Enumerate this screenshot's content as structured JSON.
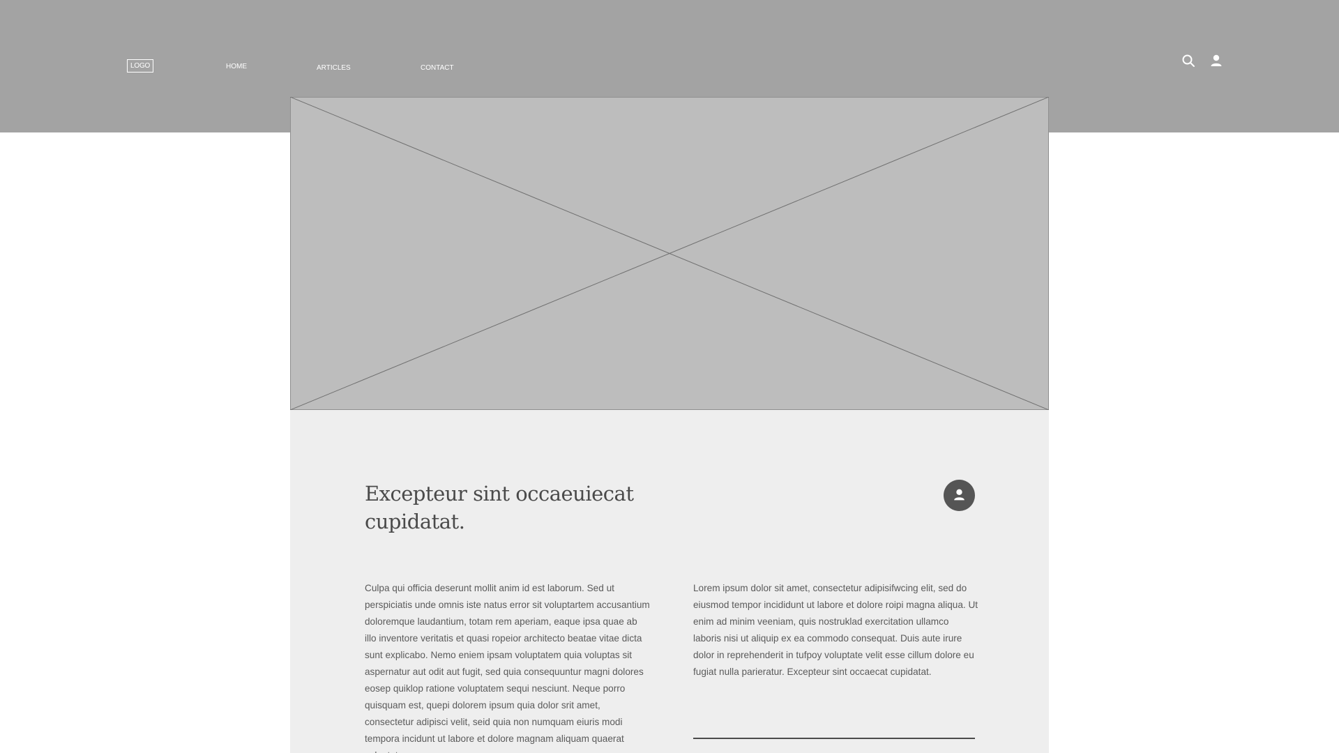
{
  "header": {
    "logo": "LOGO",
    "nav": {
      "home": "HOME",
      "articles": "ARTICLES",
      "contact": "CONTACT"
    },
    "icons": {
      "search": "search-icon",
      "user": "user-icon"
    }
  },
  "hero": {
    "type": "image-placeholder"
  },
  "article": {
    "title": "Excepteur sint occaeuiecat cupidatat.",
    "author_icon": "user-icon",
    "col_left": "Culpa qui officia deserunt mollit anim id est laborum. Sed ut perspiciatis unde omnis iste natus error sit voluptartem accusantium doloremque laudantium, totam rem aperiam, eaque ipsa quae ab illo inventore veritatis et quasi ropeior architecto beatae vitae dicta sunt explicabo. Nemo eniem ipsam voluptatem quia voluptas sit aspernatur aut odit aut fugit, sed quia consequuntur magni dolores eosep quiklop ratione voluptatem sequi nesciunt. Neque porro quisquam est, quepi dolorem ipsum quia dolor srit amet, consectetur adipisci velit, seid quia non numquam eiuris modi tempora incidunt ut labore et dolore magnam aliquam quaerat voluptatem.",
    "col_right": "Lorem ipsum dolor sit amet, consectetur adipisifwcing elit, sed do eiusmod tempor incididunt ut labore et dolore roipi magna aliqua. Ut enim ad minim veeniam, quis nostruklad exercitation ullamco laboris nisi ut aliquip ex ea commodo consequat. Duis aute irure dolor in reprehenderit in tufpoy voluptate velit esse cillum dolore eu fugiat nulla parieratur. Excepteur sint occaecat cupidatat."
  },
  "colors": {
    "header_bg": "#a3a3a3",
    "hero_bg": "#bdbdbd",
    "article_bg": "#eeeeee",
    "text": "#5a5a5a",
    "avatar_bg": "#555555"
  }
}
